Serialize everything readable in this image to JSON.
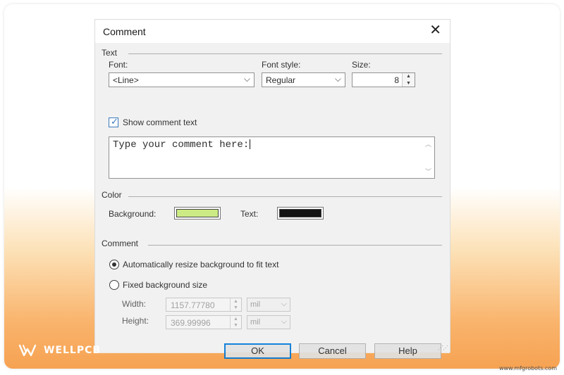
{
  "dialog": {
    "title": "Comment",
    "close_glyph": "✕"
  },
  "text_group": {
    "title": "Text",
    "font_label": "Font:",
    "font_value": "<Line>",
    "font_style_label": "Font style:",
    "font_style_value": "Regular",
    "size_label": "Size:",
    "size_value": "8",
    "show_comment_label": "Show comment text",
    "show_comment_checked": true,
    "comment_text": "Type your comment here:"
  },
  "color_group": {
    "title": "Color",
    "background_label": "Background:",
    "background_color": "#c8ea7a",
    "text_label": "Text:",
    "text_color": "#000000"
  },
  "comment_group": {
    "title": "Comment",
    "auto_resize_label": "Automatically resize background to fit text",
    "fixed_size_label": "Fixed background size",
    "selected": "auto_resize",
    "width_label": "Width:",
    "width_value": "1157.77780",
    "width_unit": "mil",
    "height_label": "Height:",
    "height_value": "369.99996",
    "height_unit": "mil"
  },
  "buttons": {
    "ok": "OK",
    "cancel": "Cancel",
    "help": "Help"
  },
  "branding": {
    "logo_text": "WELLPCB",
    "watermark": "www.mfgrobots.com",
    "accent_color": "#f6a252"
  }
}
